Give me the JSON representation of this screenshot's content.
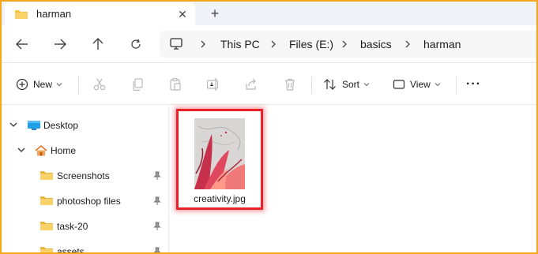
{
  "tab": {
    "title": "harman",
    "icon": "folder-icon",
    "close_label": "✕",
    "new_tab_label": "+"
  },
  "nav": {
    "back_icon": "back-arrow-icon",
    "forward_icon": "forward-arrow-icon",
    "up_icon": "up-arrow-icon",
    "refresh_icon": "refresh-icon"
  },
  "breadcrumb": {
    "root_icon": "monitor-icon",
    "items": [
      "This PC",
      "Files (E:)",
      "basics",
      "harman"
    ]
  },
  "toolbar": {
    "new_label": "New",
    "sort_label": "Sort",
    "view_label": "View",
    "more_label": "···",
    "icons": [
      "cut-icon",
      "copy-icon",
      "paste-icon",
      "rename-icon",
      "share-icon",
      "delete-icon"
    ]
  },
  "sidebar": {
    "items": [
      {
        "label": "Desktop",
        "icon": "desktop-icon",
        "expanded": true
      },
      {
        "label": "Home",
        "icon": "home-icon",
        "expanded": true
      },
      {
        "label": "Screenshots",
        "icon": "folder-icon",
        "pinned": true
      },
      {
        "label": "photoshop files",
        "icon": "folder-icon",
        "pinned": true
      },
      {
        "label": "task-20",
        "icon": "folder-icon",
        "pinned": true
      },
      {
        "label": "assets",
        "icon": "folder-icon",
        "pinned": true
      }
    ]
  },
  "files": [
    {
      "name": "creativity.jpg",
      "selected": true
    }
  ],
  "colors": {
    "window_frame": "#f3a81a",
    "highlight": "#e8202a",
    "folder": "#f4c542"
  }
}
